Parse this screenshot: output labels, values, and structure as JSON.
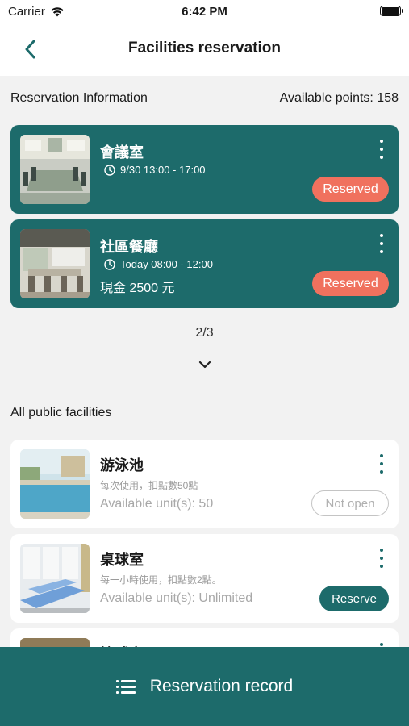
{
  "status_bar": {
    "carrier": "Carrier",
    "time": "6:42 PM"
  },
  "nav": {
    "title": "Facilities reservation"
  },
  "reservation_section": {
    "heading": "Reservation Information",
    "points_label": "Available points: 158"
  },
  "reservations": [
    {
      "name": "會議室",
      "time": "9/30 13:00 - 17:00",
      "price": "",
      "status": "Reserved"
    },
    {
      "name": "社區餐廳",
      "time": "Today 08:00 - 12:00",
      "price": "現金 2500 元",
      "status": "Reserved"
    }
  ],
  "pager": {
    "text": "2/3"
  },
  "facilities_section": {
    "heading": "All public facilities"
  },
  "facilities": [
    {
      "name": "游泳池",
      "desc": "每次使用，扣點數50點",
      "units": "Available unit(s): 50",
      "action": "Not open"
    },
    {
      "name": "桌球室",
      "desc": "每一小時使用，扣點數2點。",
      "units": "Available unit(s): Unlimited",
      "action": "Reserve"
    },
    {
      "name": "撞球室"
    }
  ],
  "bottom_bar": {
    "label": "Reservation record"
  },
  "colors": {
    "primary": "#1d6b6b",
    "reserved_badge": "#f0715e"
  }
}
